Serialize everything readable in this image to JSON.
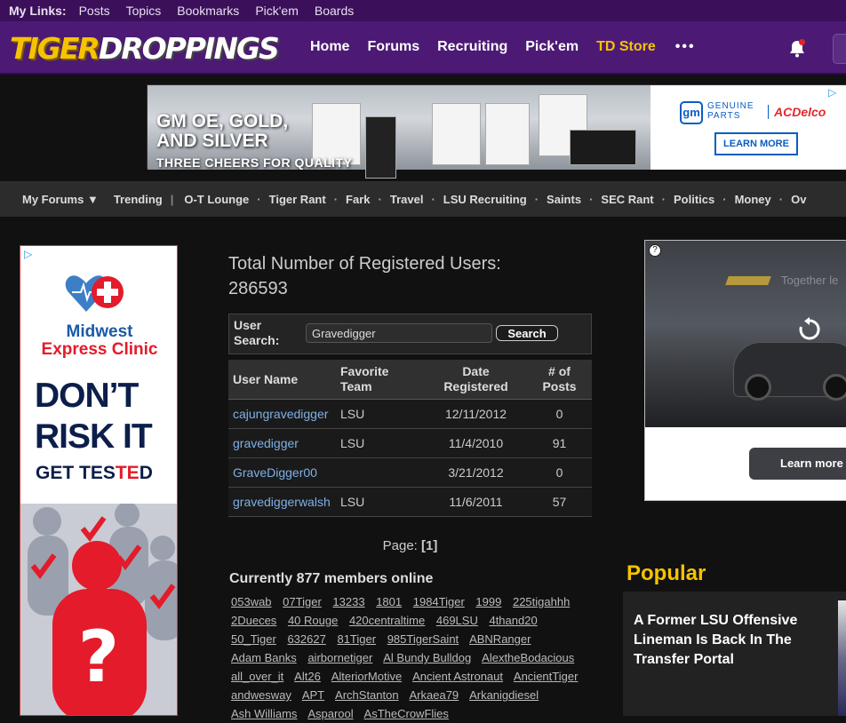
{
  "my_links": {
    "label": "My Links:",
    "items": [
      "Posts",
      "Topics",
      "Bookmarks",
      "Pick'em",
      "Boards"
    ]
  },
  "header": {
    "logo_part1": "TIGER",
    "logo_part2": "DROPPINGS",
    "nav": [
      "Home",
      "Forums",
      "Recruiting",
      "Pick'em"
    ],
    "store": "TD Store",
    "more": "•••"
  },
  "banner_ad": {
    "headline_line1": "GM OE, GOLD,",
    "headline_line2": "AND SILVER",
    "tagline": "THREE CHEERS FOR QUALITY",
    "gm_logo": "gm",
    "genuine_line1": "GENUINE",
    "genuine_line2": "PARTS",
    "brand": "ACDelco",
    "cta": "LEARN MORE"
  },
  "forum_bar": {
    "my_forums": "My Forums ▼",
    "trending": "Trending",
    "forums": [
      "O-T Lounge",
      "Tiger Rant",
      "Fark",
      "Travel",
      "LSU Recruiting",
      "Saints",
      "SEC Rant",
      "Politics",
      "Money",
      "Ov"
    ]
  },
  "left_ad": {
    "line1": "Midwest",
    "line2": "Express Clinic",
    "dont": "DON’T",
    "risk": "RISK IT",
    "tested_pre": "GET TES",
    "tested_red": "TE",
    "tested_post": "D",
    "question": "?"
  },
  "main": {
    "total_label": "Total Number of Registered Users:",
    "total_count": "286593",
    "search_label_line1": "User",
    "search_label_line2": "Search:",
    "search_value": "Gravedigger",
    "search_button": "Search",
    "columns": {
      "user_name": "User Name",
      "team_line1": "Favorite",
      "team_line2": "Team",
      "date_line1": "Date",
      "date_line2": "Registered",
      "posts_line1": "# of",
      "posts_line2": "Posts"
    },
    "rows": [
      {
        "name": "cajungravedigger",
        "team": "LSU",
        "date": "12/11/2012",
        "posts": "0"
      },
      {
        "name": "gravedigger",
        "team": "LSU",
        "date": "11/4/2010",
        "posts": "91"
      },
      {
        "name": "GraveDigger00",
        "team": "",
        "date": "3/21/2012",
        "posts": "0"
      },
      {
        "name": "gravediggerwalsh",
        "team": "LSU",
        "date": "11/6/2011",
        "posts": "57"
      }
    ],
    "page_label": "Page:",
    "page_current": "[1]",
    "online_label": "Currently 877 members online",
    "members": [
      "053wab",
      "07Tiger",
      "13233",
      "1801",
      "1984Tiger",
      "1999",
      "225tigahhh",
      "2Dueces",
      "40 Rouge",
      "420centraltime",
      "469LSU",
      "4thand20",
      "50_Tiger",
      "632627",
      "81Tiger",
      "985TigerSaint",
      "ABNRanger",
      "Adam Banks",
      "airbornetiger",
      "Al Bundy Bulldog",
      "AlextheBodacious",
      "all_over_it",
      "Alt26",
      "AlteriorMotive",
      "Ancient Astronaut",
      "AncientTiger",
      "andwesway",
      "APT",
      "ArchStanton",
      "Arkaea79",
      "Arkanigdiesel",
      "Ash Williams",
      "Asparool",
      "AsTheCrowFlies"
    ]
  },
  "right_ad": {
    "tagline": "Together le",
    "cta": "Learn more",
    "help": "?"
  },
  "popular": {
    "heading": "Popular",
    "story_title": "A Former LSU Offensive Lineman Is Back In The Transfer Portal"
  }
}
